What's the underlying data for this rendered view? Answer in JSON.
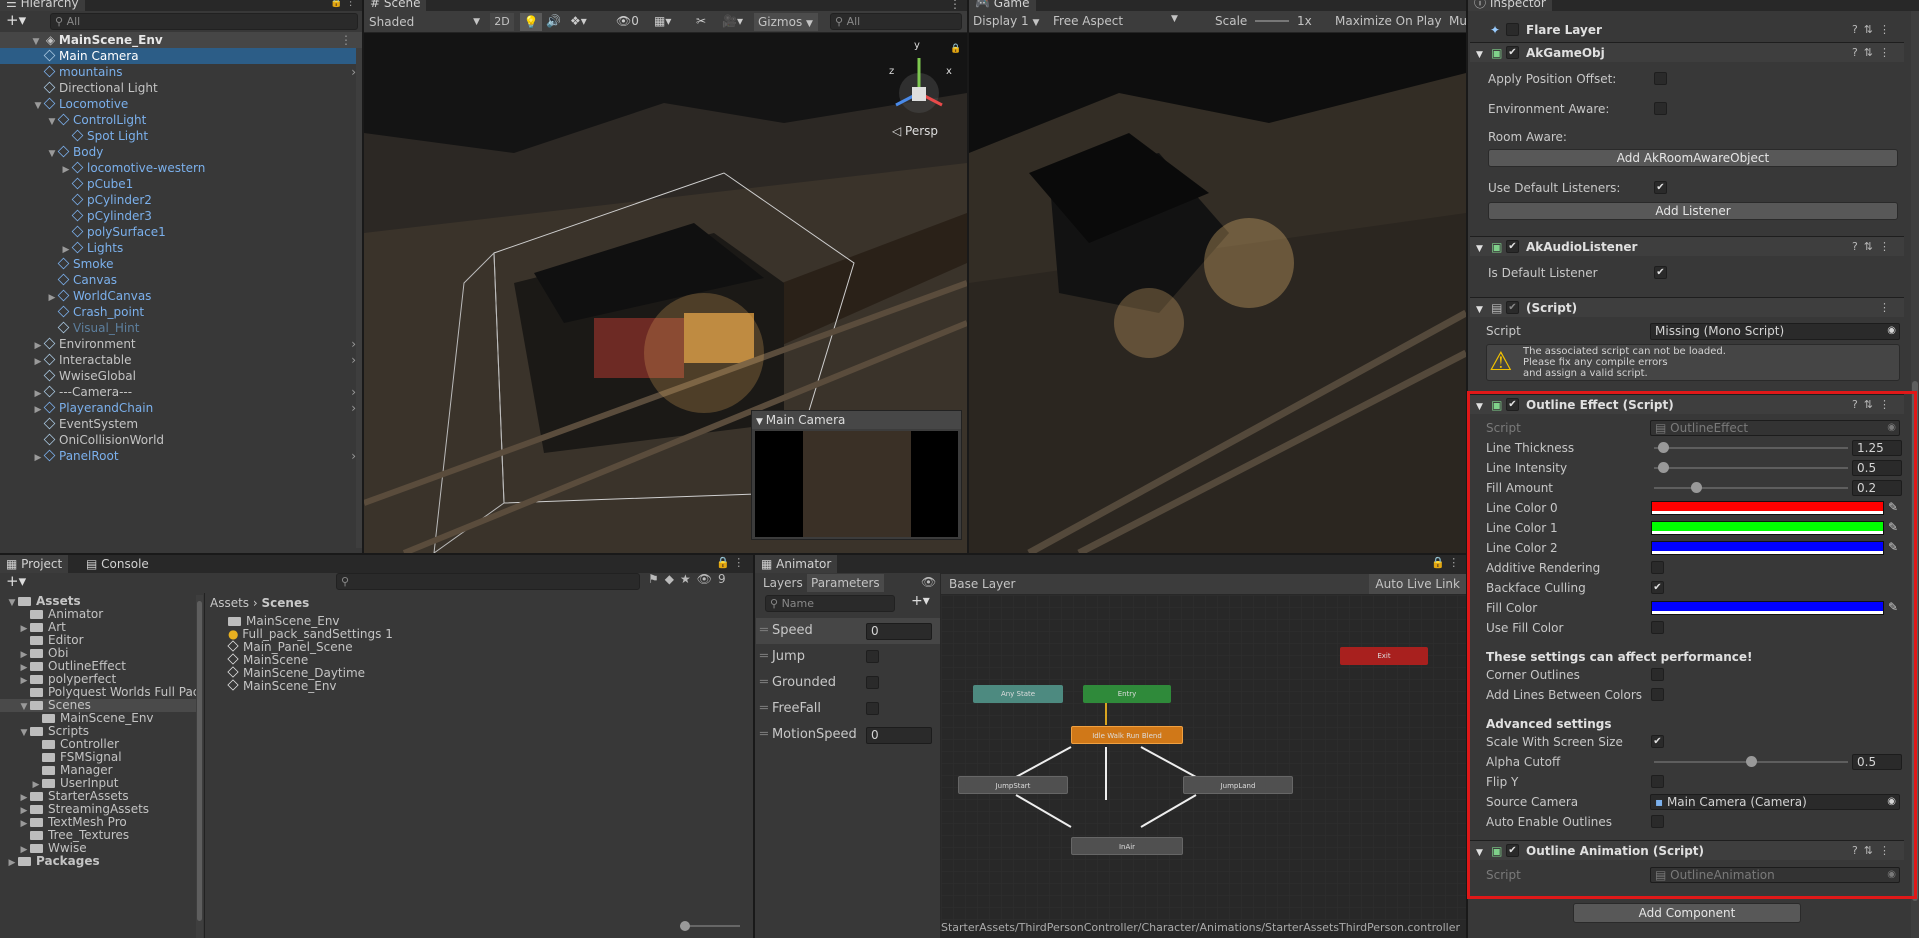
{
  "colors": {
    "accent": "#2c5d87",
    "highlight": "#e01818",
    "prefab": "#7bb0ec"
  },
  "hierarchy": {
    "tab": "Hierarchy",
    "search_placeholder": "All",
    "scene": "MainScene_Env",
    "items": [
      {
        "label": "Main Camera",
        "depth": 2,
        "selected": true,
        "blue": false,
        "exp": ""
      },
      {
        "label": "mountains",
        "depth": 2,
        "selected": false,
        "blue": true,
        "exp": ""
      },
      {
        "label": "Directional Light",
        "depth": 2,
        "selected": false,
        "blue": false,
        "exp": ""
      },
      {
        "label": "Locomotive",
        "depth": 2,
        "selected": false,
        "blue": true,
        "exp": "▼"
      },
      {
        "label": "ControlLight",
        "depth": 3,
        "selected": false,
        "blue": true,
        "exp": "▼"
      },
      {
        "label": "Spot Light",
        "depth": 4,
        "selected": false,
        "blue": true,
        "exp": ""
      },
      {
        "label": "Body",
        "depth": 3,
        "selected": false,
        "blue": true,
        "exp": "▼"
      },
      {
        "label": "locomotive-western",
        "depth": 4,
        "selected": false,
        "blue": true,
        "exp": "▶"
      },
      {
        "label": "pCube1",
        "depth": 4,
        "selected": false,
        "blue": true,
        "exp": ""
      },
      {
        "label": "pCylinder2",
        "depth": 4,
        "selected": false,
        "blue": true,
        "exp": ""
      },
      {
        "label": "pCylinder3",
        "depth": 4,
        "selected": false,
        "blue": true,
        "exp": ""
      },
      {
        "label": "polySurface1",
        "depth": 4,
        "selected": false,
        "blue": true,
        "exp": ""
      },
      {
        "label": "Lights",
        "depth": 4,
        "selected": false,
        "blue": true,
        "exp": "▶"
      },
      {
        "label": "Smoke",
        "depth": 3,
        "selected": false,
        "blue": true,
        "exp": ""
      },
      {
        "label": "Canvas",
        "depth": 3,
        "selected": false,
        "blue": true,
        "exp": ""
      },
      {
        "label": "WorldCanvas",
        "depth": 3,
        "selected": false,
        "blue": true,
        "exp": "▶"
      },
      {
        "label": "Crash_point",
        "depth": 3,
        "selected": false,
        "blue": true,
        "exp": ""
      },
      {
        "label": "Visual_Hint",
        "depth": 3,
        "selected": false,
        "blue": "dim",
        "exp": ""
      },
      {
        "label": "Environment",
        "depth": 2,
        "selected": false,
        "blue": false,
        "exp": "▶"
      },
      {
        "label": "Interactable",
        "depth": 2,
        "selected": false,
        "blue": false,
        "exp": "▶"
      },
      {
        "label": "WwiseGlobal",
        "depth": 2,
        "selected": false,
        "blue": false,
        "exp": ""
      },
      {
        "label": "---Camera---",
        "depth": 2,
        "selected": false,
        "blue": false,
        "exp": "▶"
      },
      {
        "label": "PlayerandChain",
        "depth": 2,
        "selected": false,
        "blue": true,
        "exp": "▶"
      },
      {
        "label": "EventSystem",
        "depth": 2,
        "selected": false,
        "blue": false,
        "exp": ""
      },
      {
        "label": "OniCollisionWorld",
        "depth": 2,
        "selected": false,
        "blue": false,
        "exp": ""
      },
      {
        "label": "PanelRoot",
        "depth": 2,
        "selected": false,
        "blue": true,
        "exp": "▶"
      }
    ]
  },
  "scene": {
    "tab": "Scene",
    "shading": "Shaded",
    "mode2d": "2D",
    "gizmos": "Gizmos",
    "search_placeholder": "All",
    "hidden_count": "0",
    "persp": "Persp",
    "axis_y": "y",
    "axis_z": "z",
    "axis_x": "x",
    "camera_preview_title": "Main Camera"
  },
  "game": {
    "tab": "Game",
    "display": "Display 1",
    "aspect": "Free Aspect",
    "scale_label": "Scale",
    "scale_value": "1x",
    "maximize": "Maximize On Play",
    "mute": "Mu"
  },
  "inspector": {
    "tab": "Inspector",
    "flare_layer": "Flare Layer",
    "ak_game_obj": "AkGameObj",
    "apply_position_offset": "Apply Position Offset:",
    "environment_aware": "Environment Aware:",
    "room_aware": "Room Aware:",
    "add_room_aware": "Add AkRoomAwareObject",
    "use_default_listeners": "Use Default Listeners:",
    "add_listener": "Add Listener",
    "ak_audio_listener": "AkAudioListener",
    "is_default_listener": "Is Default Listener",
    "missing_script_title": "(Script)",
    "script_label": "Script",
    "missing_script_value": "Missing (Mono Script)",
    "warning_text_1": "The associated script can not be loaded.",
    "warning_text_2": "Please fix any compile errors",
    "warning_text_3": "and assign a valid script.",
    "outline_effect": "Outline Effect (Script)",
    "outline_script_value": "OutlineEffect",
    "line_thickness_label": "Line Thickness",
    "line_thickness": "1.25",
    "line_thickness_frac": 0.02,
    "line_intensity_label": "Line Intensity",
    "line_intensity": "0.5",
    "line_intensity_frac": 0.02,
    "fill_amount_label": "Fill Amount",
    "fill_amount": "0.2",
    "fill_amount_frac": 0.2,
    "line_color_0_label": "Line Color 0",
    "line_color_0": "#ff0000",
    "line_color_1_label": "Line Color 1",
    "line_color_1": "#00ff00",
    "line_color_2_label": "Line Color 2",
    "line_color_2": "#0000ff",
    "additive_rendering": "Additive Rendering",
    "backface_culling": "Backface Culling",
    "fill_color_label": "Fill Color",
    "fill_color": "#0000ff",
    "use_fill_color": "Use Fill Color",
    "perf_heading": "These settings can affect performance!",
    "corner_outlines": "Corner Outlines",
    "add_lines": "Add Lines Between Colors",
    "advanced_heading": "Advanced settings",
    "scale_with_screen": "Scale With Screen Size",
    "alpha_cutoff_label": "Alpha Cutoff",
    "alpha_cutoff": "0.5",
    "alpha_cutoff_frac": 0.5,
    "flip_y": "Flip Y",
    "source_camera_label": "Source Camera",
    "source_camera": "Main Camera (Camera)",
    "auto_enable": "Auto Enable Outlines",
    "outline_animation": "Outline Animation (Script)",
    "outline_animation_value": "OutlineAnimation",
    "add_component": "Add Component"
  },
  "project": {
    "tab_project": "Project",
    "tab_console": "Console",
    "hidden_count": "9",
    "tree": [
      {
        "label": "Assets",
        "depth": 0,
        "exp": "▼",
        "bold": true
      },
      {
        "label": "Animator",
        "depth": 1,
        "exp": ""
      },
      {
        "label": "Art",
        "depth": 1,
        "exp": "▶"
      },
      {
        "label": "Editor",
        "depth": 1,
        "exp": ""
      },
      {
        "label": "Obi",
        "depth": 1,
        "exp": "▶"
      },
      {
        "label": "OutlineEffect",
        "depth": 1,
        "exp": "▶"
      },
      {
        "label": "polyperfect",
        "depth": 1,
        "exp": "▶"
      },
      {
        "label": "Polyquest Worlds Full Pac",
        "depth": 1,
        "exp": ""
      },
      {
        "label": "Scenes",
        "depth": 1,
        "exp": "▼",
        "sel": true
      },
      {
        "label": "MainScene_Env",
        "depth": 2,
        "exp": ""
      },
      {
        "label": "Scripts",
        "depth": 1,
        "exp": "▼"
      },
      {
        "label": "Controller",
        "depth": 2,
        "exp": ""
      },
      {
        "label": "FSMSignal",
        "depth": 2,
        "exp": ""
      },
      {
        "label": "Manager",
        "depth": 2,
        "exp": ""
      },
      {
        "label": "UserInput",
        "depth": 2,
        "exp": "▶"
      },
      {
        "label": "StarterAssets",
        "depth": 1,
        "exp": "▶"
      },
      {
        "label": "StreamingAssets",
        "depth": 1,
        "exp": "▶"
      },
      {
        "label": "TextMesh Pro",
        "depth": 1,
        "exp": "▶"
      },
      {
        "label": "Tree_Textures",
        "depth": 1,
        "exp": ""
      },
      {
        "label": "Wwise",
        "depth": 1,
        "exp": "▶"
      },
      {
        "label": "Packages",
        "depth": 0,
        "exp": "▶",
        "bold": true
      }
    ],
    "breadcrumb_root": "Assets",
    "breadcrumb_leaf": "Scenes",
    "files": [
      {
        "label": "MainScene_Env",
        "kind": "folder"
      },
      {
        "label": "Full_pack_sandSettings 1",
        "kind": "settings"
      },
      {
        "label": "Main_Panel_Scene",
        "kind": "scene"
      },
      {
        "label": "MainScene",
        "kind": "scene"
      },
      {
        "label": "MainScene_Daytime",
        "kind": "scene"
      },
      {
        "label": "MainScene_Env",
        "kind": "scene"
      }
    ]
  },
  "animator": {
    "tab": "Animator",
    "layers": "Layers",
    "parameters": "Parameters",
    "base_layer": "Base Layer",
    "auto_live_link": "Auto Live Link",
    "name_placeholder": "Name",
    "params": [
      {
        "label": "Speed",
        "type": "float",
        "value": "0"
      },
      {
        "label": "Jump",
        "type": "bool",
        "value": ""
      },
      {
        "label": "Grounded",
        "type": "bool",
        "value": ""
      },
      {
        "label": "FreeFall",
        "type": "bool",
        "value": ""
      },
      {
        "label": "MotionSpeed",
        "type": "float",
        "value": "0"
      }
    ],
    "nodes": {
      "any_state": "Any State",
      "entry": "Entry",
      "exit": "Exit",
      "idle": "Idle Walk Run Blend",
      "jump_start": "JumpStart",
      "jump_land": "JumpLand",
      "in_air": "InAir"
    },
    "path": "StarterAssets/ThirdPersonController/Character/Animations/StarterAssetsThirdPerson.controller"
  }
}
